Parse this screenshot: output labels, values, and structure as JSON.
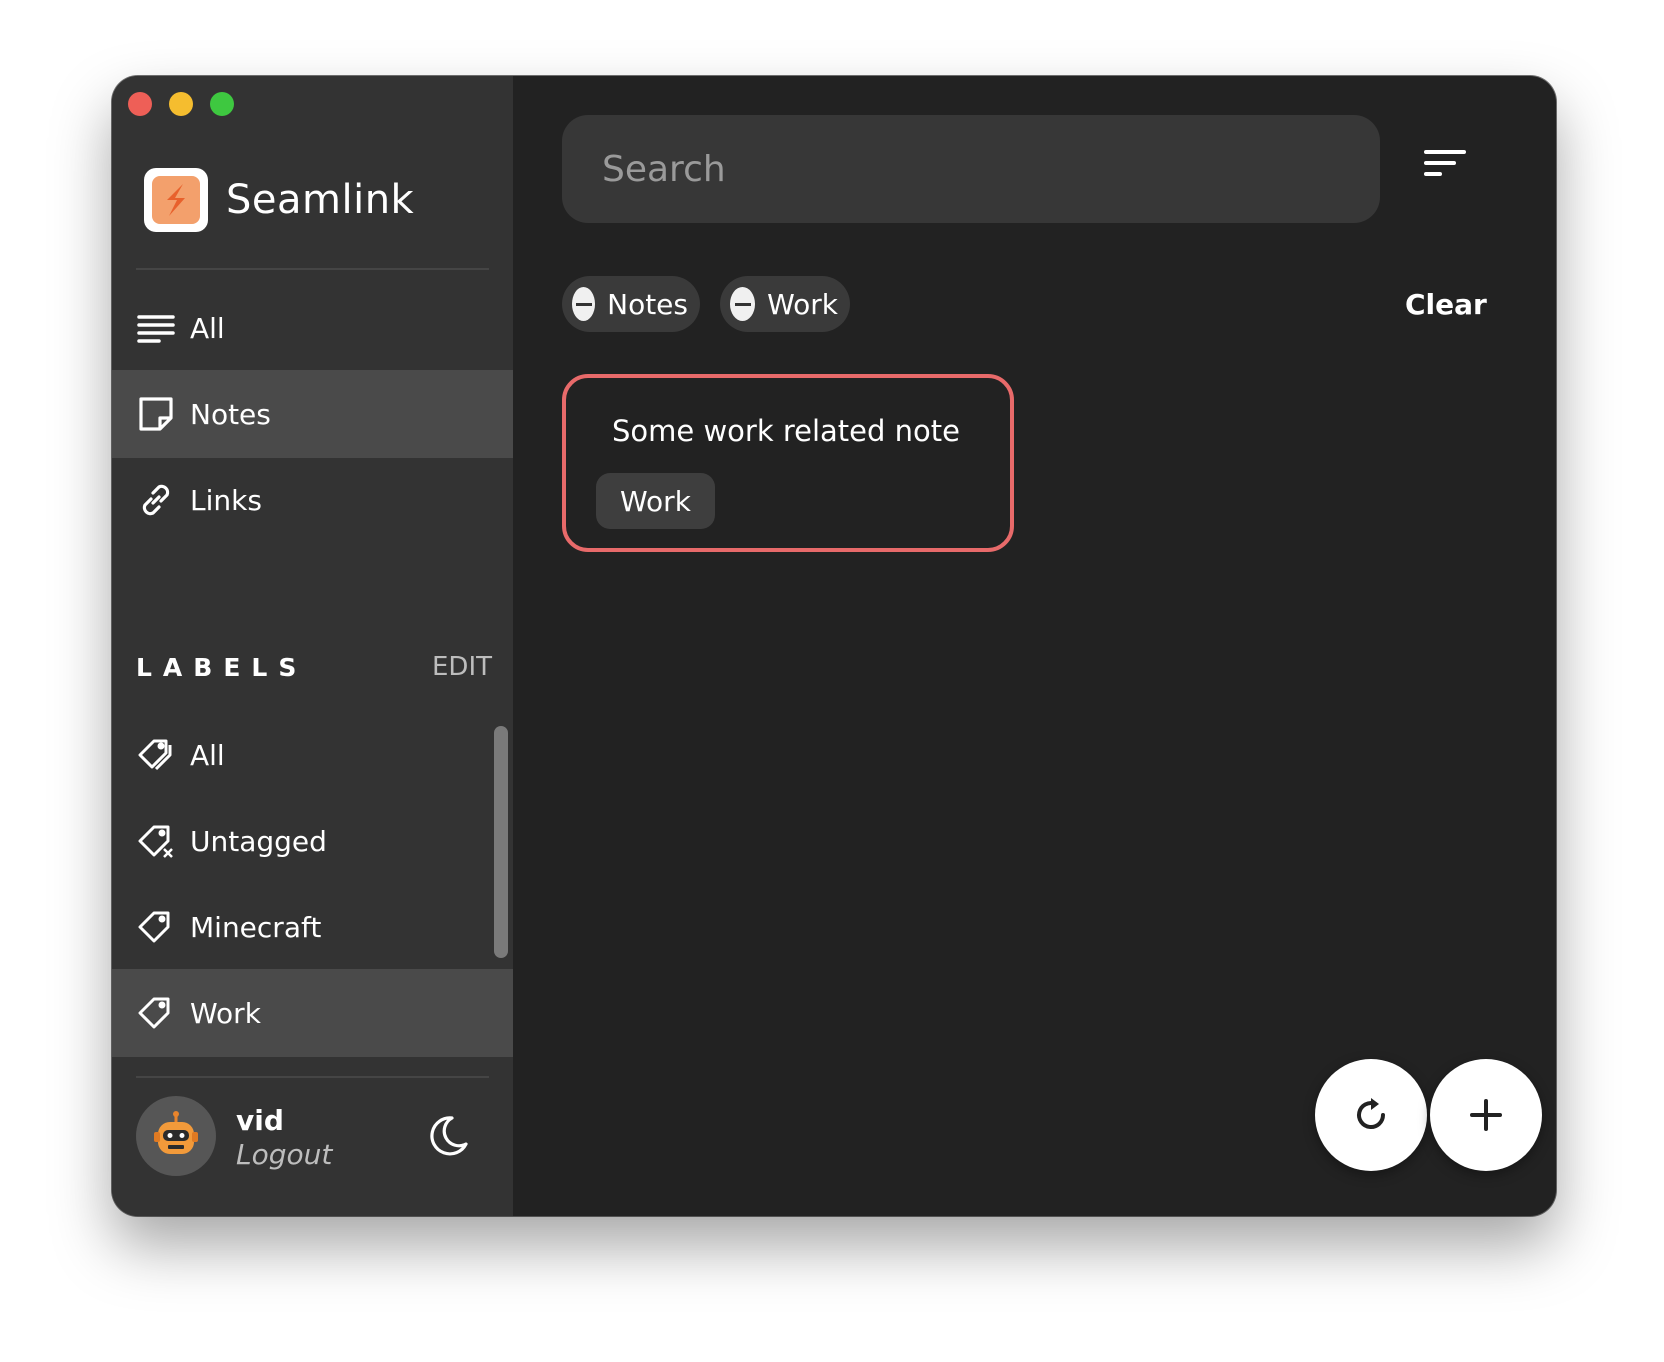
{
  "app": {
    "name": "Seamlink"
  },
  "window_controls": [
    "close",
    "minimize",
    "zoom"
  ],
  "sidebar": {
    "nav": [
      {
        "label": "All",
        "icon": "list-icon"
      },
      {
        "label": "Notes",
        "icon": "note-icon",
        "active": true
      },
      {
        "label": "Links",
        "icon": "link-icon"
      }
    ],
    "labels_title": "LABELS",
    "labels_edit": "EDIT",
    "labels": [
      {
        "label": "All",
        "icon": "tags-icon"
      },
      {
        "label": "Untagged",
        "icon": "tag-untagged-icon"
      },
      {
        "label": "Minecraft",
        "icon": "tag-icon"
      },
      {
        "label": "Work",
        "icon": "tag-icon",
        "active": true
      }
    ],
    "user": {
      "name": "vid",
      "logout": "Logout"
    }
  },
  "main": {
    "search_placeholder": "Search",
    "filters": [
      "Notes",
      "Work"
    ],
    "clear_label": "Clear",
    "notes": [
      {
        "title": "Some work related note",
        "tags": [
          "Work"
        ]
      }
    ]
  },
  "colors": {
    "sidebar_bg": "#333333",
    "main_bg": "#222222",
    "active_item": "#4a4a4a",
    "card_border": "#e86a6a",
    "logo_accent": "#f3a06c"
  }
}
